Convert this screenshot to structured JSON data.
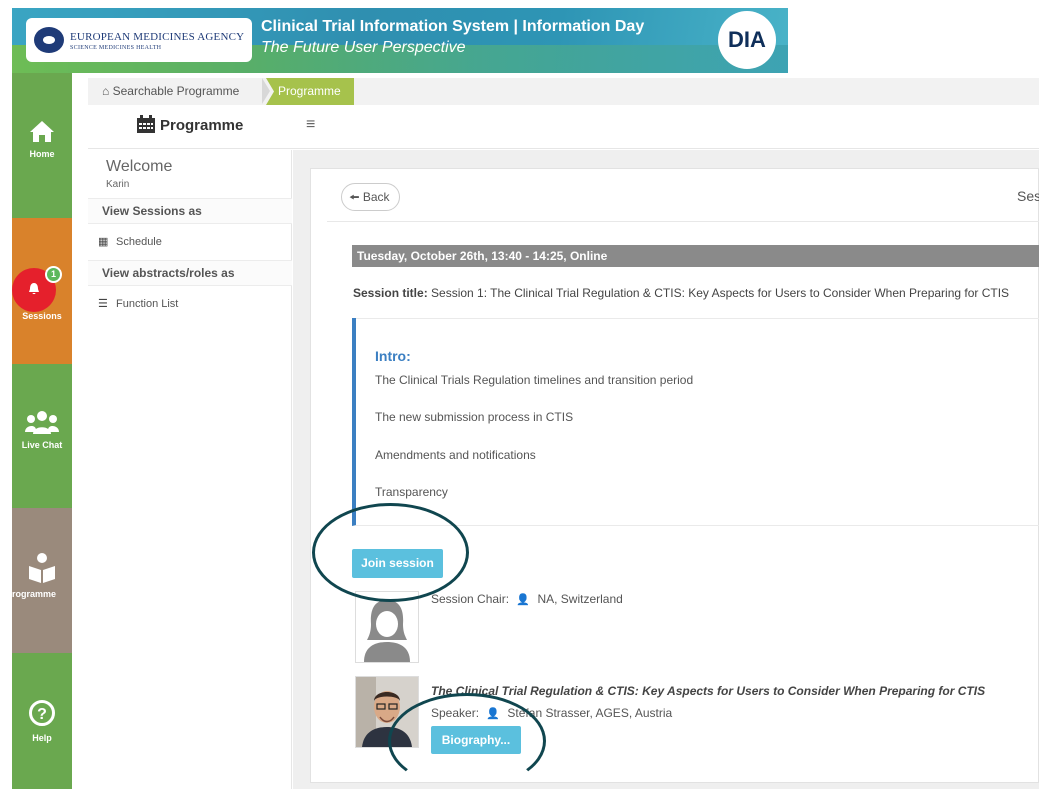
{
  "banner": {
    "org_name": "EUROPEAN MEDICINES AGENCY",
    "org_tagline": "SCIENCE MEDICINES HEALTH",
    "title": "Clinical Trial Information System | Information Day",
    "subtitle": "The Future User Perspective",
    "partner_logo": "DIA"
  },
  "rail": {
    "items": [
      {
        "label": "Home",
        "icon": "home-icon"
      },
      {
        "label": "Sessions",
        "icon": "bell-icon",
        "badge": "1"
      },
      {
        "label": "Live Chat",
        "icon": "users-icon"
      },
      {
        "label": "rogramme",
        "icon": "reader-icon"
      },
      {
        "label": "Help",
        "icon": "help-icon"
      }
    ],
    "colors": {
      "home": "#6aa84f",
      "sessions": "#d9822b",
      "programme": "#9a8a7c"
    }
  },
  "breadcrumb": {
    "home_label": "Searchable Programme",
    "active_label": "Programme",
    "active_color": "#a6c24c"
  },
  "subheader": {
    "title": "Programme",
    "menu_icon": "hamburger-icon"
  },
  "sidebar": {
    "welcome": "Welcome",
    "user_name": "Karin",
    "view_sessions_heading": "View Sessions as",
    "schedule_label": "Schedule",
    "view_abstracts_heading": "View abstracts/roles as",
    "function_list_label": "Function List"
  },
  "main": {
    "back_label": "Back",
    "title_fragment": "Ses",
    "date_bar": "Tuesday, October 26th, 13:40 - 14:25, Online",
    "session_title_label": "Session title:",
    "session_title": "Session 1: The Clinical Trial Regulation & CTIS: Key Aspects for Users to Consider When Preparing for CTIS",
    "intro": {
      "heading": "Intro:",
      "lines": [
        "The Clinical Trials Regulation timelines and transition period",
        "The new submission process in CTIS",
        "Amendments and notifications",
        "Transparency"
      ]
    },
    "join_label": "Join session",
    "chair": {
      "label": "Session Chair:",
      "name": "NA, Switzerland"
    },
    "talk": {
      "title": "The Clinical Trial Regulation & CTIS: Key Aspects for Users to Consider When Preparing for CTIS",
      "speaker_label": "Speaker:",
      "speaker_name": "Stefan Strasser, AGES, Austria",
      "biography_label": "Biography..."
    },
    "accent_color": "#5bc0de"
  }
}
